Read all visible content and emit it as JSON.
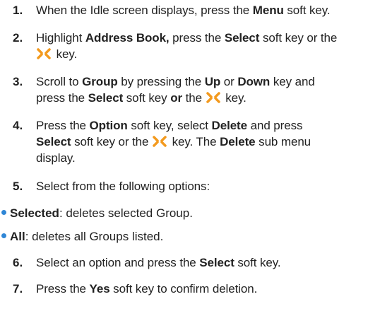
{
  "steps": [
    {
      "number": "1.",
      "parts": [
        "When the Idle screen displays, press the ",
        "Menu",
        " soft key."
      ]
    },
    {
      "number": "2.",
      "parts": [
        "Highlight ",
        "Address Book,",
        " press the ",
        "Select",
        " soft key or the",
        " key."
      ]
    },
    {
      "number": "3.",
      "parts": [
        "Scroll to ",
        "Group",
        " by pressing the ",
        "Up",
        " or ",
        "Down",
        " key and",
        "press the ",
        "Select",
        " soft key ",
        "or",
        " the ",
        " key."
      ]
    },
    {
      "number": "4.",
      "parts": [
        "Press the ",
        "Option",
        " soft key, select ",
        "Delete",
        " and press",
        "Select",
        " soft key or the ",
        " key. The ",
        "Delete",
        " sub menu",
        "display."
      ]
    },
    {
      "number": "5.",
      "parts": [
        "Select from the following options:"
      ]
    },
    {
      "number": "6.",
      "parts": [
        "Select an option and press the ",
        "Select",
        " soft key."
      ]
    },
    {
      "number": "7.",
      "parts": [
        "Press the ",
        "Yes",
        " soft key to confirm deletion."
      ]
    }
  ],
  "bullets": [
    {
      "term": "Selected",
      "desc": ": deletes selected Group."
    },
    {
      "term": "All",
      "desc": ": deletes all Groups listed."
    }
  ],
  "icon": {
    "name": "ok-key-icon",
    "color": "#f39a1e"
  },
  "bullet_color": "#2f86d6"
}
